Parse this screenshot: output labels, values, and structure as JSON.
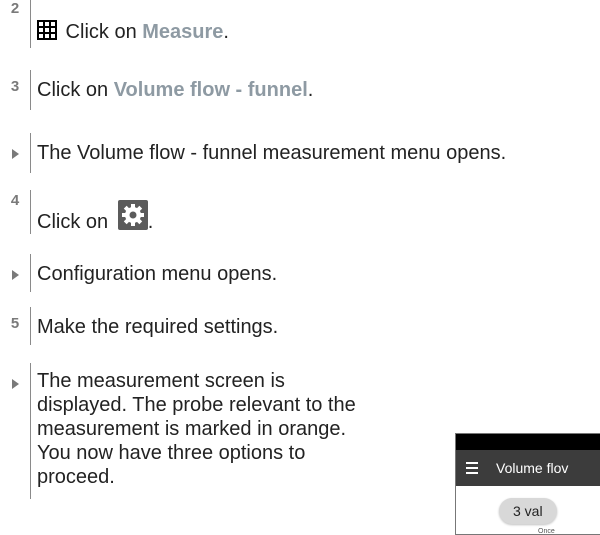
{
  "steps": [
    {
      "marker": "2",
      "prefix": " Click on ",
      "highlight": "Measure",
      "suffix": ".",
      "icon": "grid-icon"
    },
    {
      "marker": "3",
      "prefix": "Click on ",
      "highlight": "Volume flow - funnel",
      "suffix": "."
    },
    {
      "marker": "result",
      "text": "The Volume flow - funnel measurement menu opens."
    },
    {
      "marker": "4",
      "prefix": "Click on ",
      "suffix": ".",
      "icon": "gear-icon"
    },
    {
      "marker": "result",
      "text": "Configuration menu opens."
    },
    {
      "marker": "5",
      "text": "Make the required settings."
    },
    {
      "marker": "result",
      "lines": [
        "The measurement screen is",
        "displayed. The probe relevant to the",
        "measurement is marked in orange.",
        "You now have three options to",
        "proceed."
      ]
    }
  ],
  "phone": {
    "title": "Volume flov",
    "pill": "3 val",
    "tiny": "Once"
  },
  "colors": {
    "highlight": "#8e9aa3",
    "marker": "#7a7a7a",
    "appbar": "#3c3c3c"
  }
}
